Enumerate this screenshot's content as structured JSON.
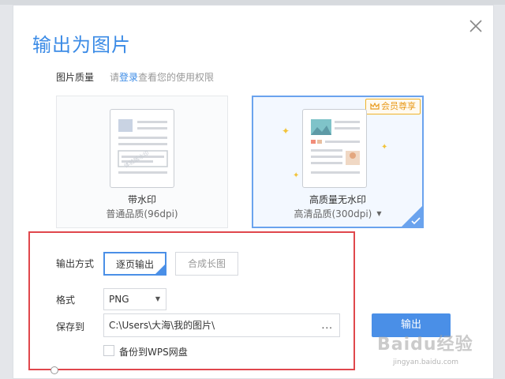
{
  "dialog": {
    "title": "输出为图片",
    "quality_label": "图片质量",
    "login_hint": {
      "prefix": "请",
      "link": "登录",
      "suffix": "查看您的使用权限"
    }
  },
  "cards": {
    "watermark": {
      "name": "带水印",
      "sub": "普通品质(96dpi)",
      "thumb_watermark_text": "体验版水印"
    },
    "no_watermark": {
      "name": "高质量无水印",
      "sub": "高清品质(300dpi)",
      "badge": "会员尊享",
      "selected": true
    }
  },
  "output_mode": {
    "label": "输出方式",
    "options": [
      "逐页输出",
      "合成长图"
    ],
    "selected": "逐页输出"
  },
  "format": {
    "label": "格式",
    "value": "PNG"
  },
  "save_to": {
    "label": "保存到",
    "path": "C:\\Users\\大海\\我的图片\\",
    "browse": "..."
  },
  "backup": {
    "label": "备份到WPS网盘",
    "checked": false
  },
  "export_button": "输出",
  "watermark_logo": {
    "main": "Baidu经验",
    "sub": "jingyan.baidu.com"
  },
  "colors": {
    "accent": "#4a8fe7",
    "title": "#3b8be6",
    "highlight": "#e0474c",
    "vip": "#e89a1c"
  }
}
